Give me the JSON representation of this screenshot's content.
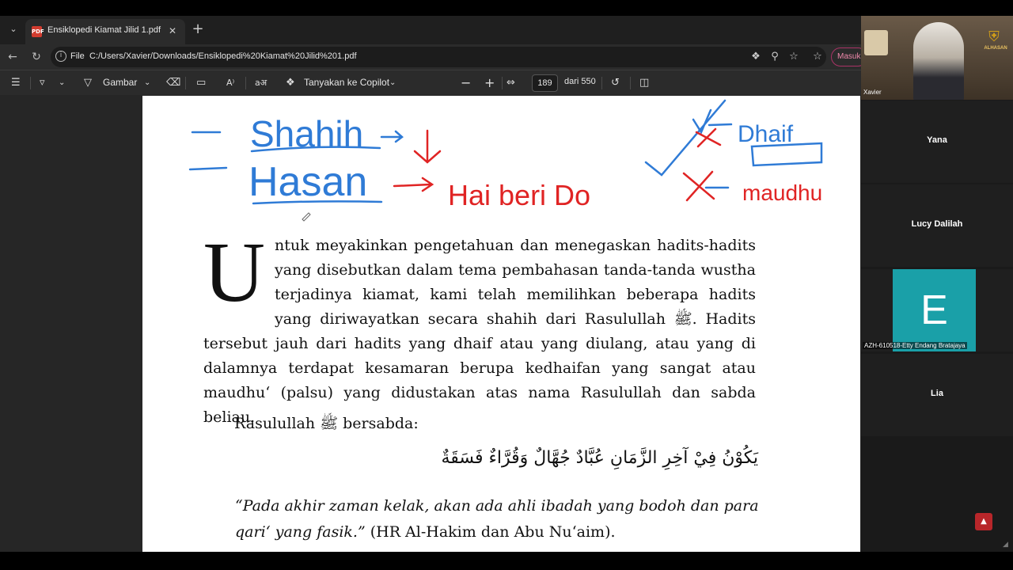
{
  "browser": {
    "tab_title": "Ensiklopedi Kiamat Jilid 1.pdf",
    "new_tab_symbol": "+",
    "scheme_label": "File",
    "url": "C:/Users/Xavier/Downloads/Ensiklopedi%20Kiamat%20Jilid%201.pdf",
    "profile_button": "Masuk"
  },
  "pdf_toolbar": {
    "draw_label": "Gambar",
    "copilot_label": "Tanyakan ke Copilot",
    "page_number": "189",
    "page_total": "dari 550",
    "read_aloud_glyph": "A⁾",
    "translate_glyph": "aअ"
  },
  "document": {
    "annotations": {
      "shahih": "Shahih",
      "hasan": "Hasan",
      "hasan_note": "Hai beri Do",
      "dhaif": "Dhaif",
      "maudhu": "maudhu"
    },
    "drop_cap": "U",
    "paragraph1": "ntuk meyakinkan pengetahuan dan menegaskan hadits-hadits yang disebutkan dalam tema pembahasan tanda-tanda wustha terjadinya kiamat, kami telah memilihkan beberapa hadits yang diriwayatkan secara shahih dari Rasulullah ﷺ. Hadits tersebut jauh dari hadits yang dhaif atau yang diulang, atau yang di dalamnya terdapat kesamaran berupa kedhaifan yang sangat atau maudhu‘ (palsu) yang didustakan atas nama Rasulullah dan sabda beliau.",
    "paragraph2": "Rasulullah ﷺ bersabda:",
    "arabic": "يَكُوْنُ فِيْ آخِرِ الزَّمَانِ عُبَّادٌ جُهَّالٌ وَقُرَّاءٌ فَسَقَةٌ",
    "quote_italic": "“Pada akhir zaman kelak, akan ada ahli ibadah yang bodoh dan para qari‘ yang fasik.”",
    "quote_source": " (HR Al-Hakim dan Abu Nu‘aim)."
  },
  "meeting": {
    "self_name": "Xavier",
    "logo_text": "ALHASAN",
    "participants": [
      {
        "name": "Yana"
      },
      {
        "name": "Lucy Dalilah"
      },
      {
        "name": "AZH-610518-Etty Endang Bratajaya",
        "initial": "E"
      },
      {
        "name": "Lia"
      }
    ]
  },
  "colors": {
    "ink_blue": "#2f7bd6",
    "ink_red": "#e02424",
    "avatar_teal": "#1aa0a8"
  }
}
